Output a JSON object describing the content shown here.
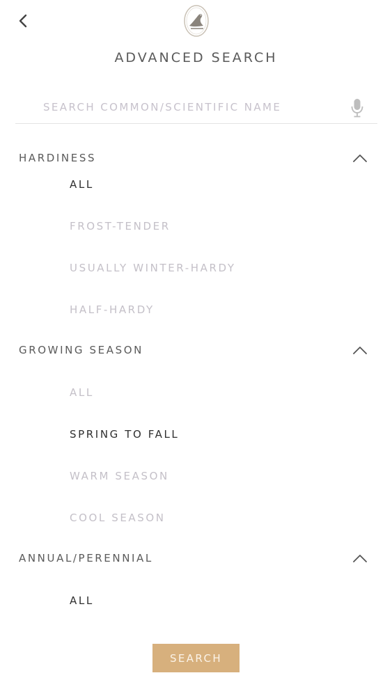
{
  "header": {
    "back_icon": "chevron-left-icon",
    "logo_icon": "bird-logo-icon",
    "title": "ADVANCED SEARCH"
  },
  "search": {
    "value": "",
    "placeholder": "SEARCH COMMON/SCIENTIFIC NAME",
    "mic_icon": "microphone-icon"
  },
  "sections": [
    {
      "title": "HARDINESS",
      "expanded": true,
      "options": [
        {
          "label": "ALL",
          "selected": true
        },
        {
          "label": "FROST-TENDER",
          "selected": false
        },
        {
          "label": "USUALLY WINTER-HARDY",
          "selected": false
        },
        {
          "label": "HALF-HARDY",
          "selected": false
        }
      ]
    },
    {
      "title": "GROWING SEASON",
      "expanded": true,
      "options": [
        {
          "label": "ALL",
          "selected": false
        },
        {
          "label": "SPRING TO FALL",
          "selected": true
        },
        {
          "label": "WARM SEASON",
          "selected": false
        },
        {
          "label": "COOL SEASON",
          "selected": false
        }
      ]
    },
    {
      "title": "ANNUAL/PERENNIAL",
      "expanded": true,
      "options": [
        {
          "label": "ALL",
          "selected": true
        }
      ]
    }
  ],
  "footer": {
    "search_label": "SEARCH"
  },
  "colors": {
    "accent": "#d7b07d",
    "selected_text": "#2f2f2f",
    "unselected_text": "#c4c0c8",
    "header_text": "#5a5a5a"
  }
}
